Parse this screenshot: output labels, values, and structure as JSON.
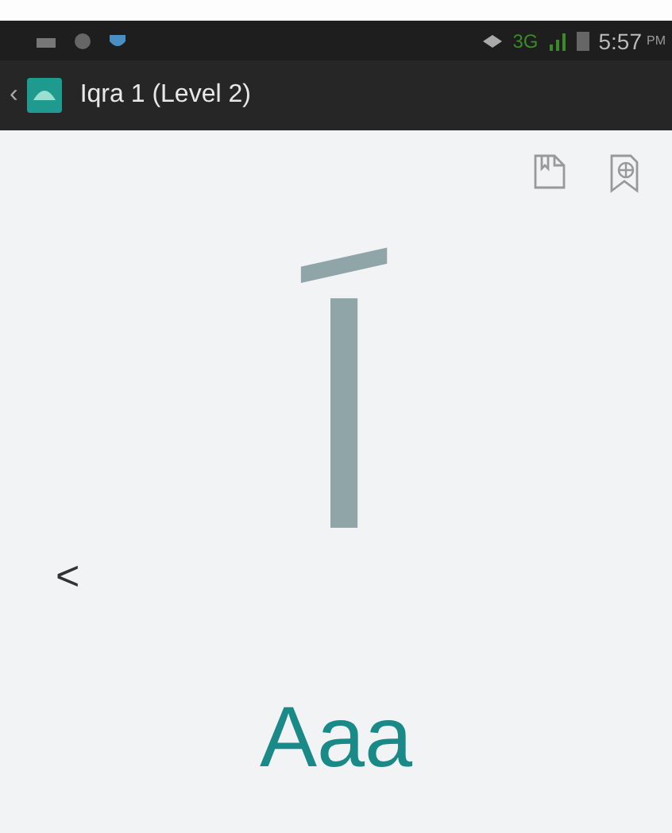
{
  "status_bar": {
    "network": "3G",
    "time": "5:57",
    "ampm": "PM"
  },
  "action_bar": {
    "back": "‹",
    "title": "Iqra 1 (Level 2)"
  },
  "lesson": {
    "letter": "اَ",
    "previous": "<",
    "transliteration": "Aaa"
  }
}
